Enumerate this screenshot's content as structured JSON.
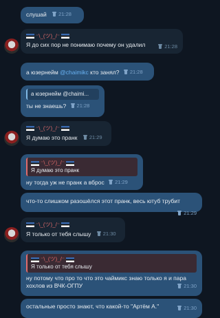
{
  "messages": [
    {
      "text": "слушай",
      "time": "21:28"
    },
    {
      "sender": "⁻\\_(ツ)_/⁻",
      "text": "Я до сих пор не понимаю почему он удалил",
      "time": "21:28"
    },
    {
      "text_pre": "а юзернейм ",
      "handle": "@chaimikc",
      "text_post": " кто занял?",
      "time": "21:28"
    },
    {
      "quote": "а юзернейм @chaimi...",
      "text": "ты не знаешь?",
      "time": "21:28"
    },
    {
      "sender": "⁻\\_(ツ)_/⁻",
      "text": "Я думаю это пранк",
      "time": "21:29"
    },
    {
      "quote_sender": "⁻\\_(ツ)_/⁻",
      "quote": "Я думаю это пранк",
      "text": "ну тогда уж не пранк а вброс",
      "time": "21:29"
    },
    {
      "text": "что-то слишком разошёлся этот пранк, весь ютуб трубит",
      "time": "21:29"
    },
    {
      "sender": "⁻\\_(ツ)_/⁻",
      "text": "Я только от тебя слышу",
      "time": "21:30"
    },
    {
      "quote_sender": "⁻\\_(ツ)_/⁻",
      "quote": "Я только от тебя слышу",
      "text": "ну потому что про то что это чаймикс знаю только я и пара хохлов из ВЧК-ОГПУ",
      "time": "21:30"
    },
    {
      "text": "остальные просто знают, что какой-то \"Артём А.\"",
      "time": "21:30"
    }
  ]
}
